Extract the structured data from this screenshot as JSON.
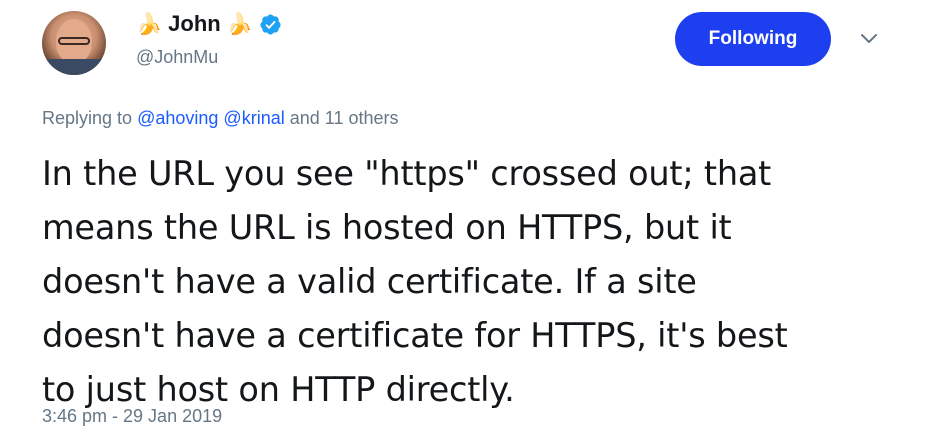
{
  "user": {
    "display_name": "John",
    "emoji_left": "🍌",
    "emoji_right": "🍌",
    "handle": "@JohnMu",
    "verified_icon": "verified-badge-icon"
  },
  "actions": {
    "follow_label": "Following",
    "menu_icon": "chevron-down-icon"
  },
  "reply": {
    "prefix": "Replying to",
    "mention_1": "@ahoving",
    "mention_2": "@krinal",
    "suffix": "and 11 others"
  },
  "tweet": {
    "text_lines": [
      "In the URL you see \"https\" crossed out; that",
      "means the URL is hosted on HTTPS, but it",
      "doesn't have a valid certificate. If a site",
      "doesn't have a certificate for HTTPS, it's best",
      "to just host on HTTP directly."
    ],
    "timestamp": "3:46 pm - 29 Jan 2019"
  },
  "colors": {
    "button_bg": "#1d3ff0",
    "link": "#1b5cff",
    "muted": "#657786",
    "verified": "#1da1f2"
  }
}
